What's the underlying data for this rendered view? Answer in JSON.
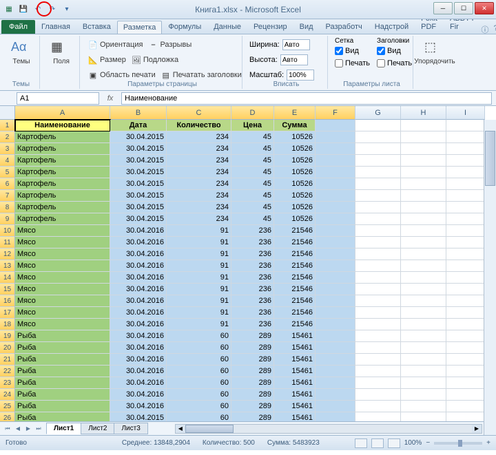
{
  "title": "Книга1.xlsx - Microsoft Excel",
  "tabs": [
    "Файл",
    "Главная",
    "Вставка",
    "Разметка",
    "Формулы",
    "Данные",
    "Рецензир",
    "Вид",
    "Разработч",
    "Надстрой",
    "Foxit PDF",
    "ABBYY Fir"
  ],
  "active_tab": 3,
  "ribbon": {
    "themes_label": "Темы",
    "themes_btn": "Темы",
    "fields_btn": "Поля",
    "orient": "Ориентация",
    "size": "Размер",
    "print_area": "Область печати",
    "breaks": "Разрывы",
    "background": "Подложка",
    "print_titles": "Печатать заголовки",
    "page_setup_label": "Параметры страницы",
    "width_lbl": "Ширина:",
    "width_val": "Авто",
    "height_lbl": "Высота:",
    "height_val": "Авто",
    "scale_lbl": "Масштаб:",
    "scale_val": "100%",
    "fit_label": "Вписать",
    "grid_lbl": "Сетка",
    "headings_lbl": "Заголовки",
    "view_chk": "Вид",
    "print_chk": "Печать",
    "sheet_opts_label": "Параметры листа",
    "arrange": "Упорядочить"
  },
  "namebox": "A1",
  "formula": "Наименование",
  "columns": [
    "A",
    "B",
    "C",
    "D",
    "E",
    "F",
    "G",
    "H",
    "I"
  ],
  "headers": [
    "Наименование",
    "Дата",
    "Количество",
    "Цена",
    "Сумма"
  ],
  "rows": [
    {
      "n": 1,
      "kind": "header"
    },
    {
      "n": 2,
      "name": "Картофель",
      "date": "30.04.2015",
      "qty": "234",
      "price": "45",
      "sum": "10526"
    },
    {
      "n": 3,
      "name": "Картофель",
      "date": "30.04.2015",
      "qty": "234",
      "price": "45",
      "sum": "10526"
    },
    {
      "n": 4,
      "name": "Картофель",
      "date": "30.04.2015",
      "qty": "234",
      "price": "45",
      "sum": "10526"
    },
    {
      "n": 5,
      "name": "Картофель",
      "date": "30.04.2015",
      "qty": "234",
      "price": "45",
      "sum": "10526"
    },
    {
      "n": 6,
      "name": "Картофель",
      "date": "30.04.2015",
      "qty": "234",
      "price": "45",
      "sum": "10526"
    },
    {
      "n": 7,
      "name": "Картофель",
      "date": "30.04.2015",
      "qty": "234",
      "price": "45",
      "sum": "10526"
    },
    {
      "n": 8,
      "name": "Картофель",
      "date": "30.04.2015",
      "qty": "234",
      "price": "45",
      "sum": "10526"
    },
    {
      "n": 9,
      "name": "Картофель",
      "date": "30.04.2015",
      "qty": "234",
      "price": "45",
      "sum": "10526"
    },
    {
      "n": 10,
      "name": "Мясо",
      "date": "30.04.2016",
      "qty": "91",
      "price": "236",
      "sum": "21546"
    },
    {
      "n": 11,
      "name": "Мясо",
      "date": "30.04.2016",
      "qty": "91",
      "price": "236",
      "sum": "21546"
    },
    {
      "n": 12,
      "name": "Мясо",
      "date": "30.04.2016",
      "qty": "91",
      "price": "236",
      "sum": "21546"
    },
    {
      "n": 13,
      "name": "Мясо",
      "date": "30.04.2016",
      "qty": "91",
      "price": "236",
      "sum": "21546"
    },
    {
      "n": 14,
      "name": "Мясо",
      "date": "30.04.2016",
      "qty": "91",
      "price": "236",
      "sum": "21546"
    },
    {
      "n": 15,
      "name": "Мясо",
      "date": "30.04.2016",
      "qty": "91",
      "price": "236",
      "sum": "21546"
    },
    {
      "n": 16,
      "name": "Мясо",
      "date": "30.04.2016",
      "qty": "91",
      "price": "236",
      "sum": "21546"
    },
    {
      "n": 17,
      "name": "Мясо",
      "date": "30.04.2016",
      "qty": "91",
      "price": "236",
      "sum": "21546"
    },
    {
      "n": 18,
      "name": "Мясо",
      "date": "30.04.2016",
      "qty": "91",
      "price": "236",
      "sum": "21546"
    },
    {
      "n": 19,
      "name": "Рыба",
      "date": "30.04.2016",
      "qty": "60",
      "price": "289",
      "sum": "15461"
    },
    {
      "n": 20,
      "name": "Рыба",
      "date": "30.04.2016",
      "qty": "60",
      "price": "289",
      "sum": "15461"
    },
    {
      "n": 21,
      "name": "Рыба",
      "date": "30.04.2016",
      "qty": "60",
      "price": "289",
      "sum": "15461"
    },
    {
      "n": 22,
      "name": "Рыба",
      "date": "30.04.2016",
      "qty": "60",
      "price": "289",
      "sum": "15461"
    },
    {
      "n": 23,
      "name": "Рыба",
      "date": "30.04.2016",
      "qty": "60",
      "price": "289",
      "sum": "15461"
    },
    {
      "n": 24,
      "name": "Рыба",
      "date": "30.04.2016",
      "qty": "60",
      "price": "289",
      "sum": "15461"
    },
    {
      "n": 25,
      "name": "Рыба",
      "date": "30.04.2016",
      "qty": "60",
      "price": "289",
      "sum": "15461"
    },
    {
      "n": 26,
      "name": "Рыба",
      "date": "30.04.2015",
      "qty": "60",
      "price": "289",
      "sum": "15461"
    }
  ],
  "sheets": [
    "Лист1",
    "Лист2",
    "Лист3"
  ],
  "active_sheet": 0,
  "status": {
    "ready": "Готово",
    "avg_lbl": "Среднее:",
    "avg": "13848,2904",
    "count_lbl": "Количество:",
    "count": "500",
    "sum_lbl": "Сумма:",
    "sum": "5483923",
    "zoom": "100%"
  }
}
